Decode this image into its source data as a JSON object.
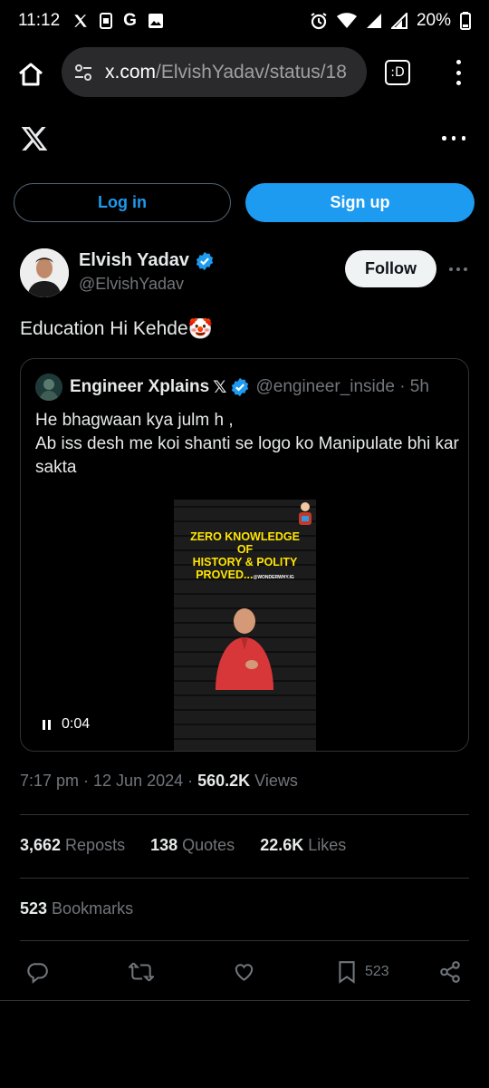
{
  "status_bar": {
    "time": "11:12",
    "battery": "20%",
    "icons": [
      "x-icon",
      "sim-icon",
      "google-icon",
      "image-icon",
      "alarm-icon",
      "wifi-icon",
      "signal-icon",
      "battery-icon"
    ]
  },
  "browser": {
    "url_host": "x.com",
    "url_path": "/ElvishYadav/status/18",
    "tabs_label": ":D"
  },
  "header": {
    "login_label": "Log in",
    "signup_label": "Sign up"
  },
  "tweet": {
    "author_name": "Elvish Yadav",
    "author_handle": "@ElvishYadav",
    "follow_label": "Follow",
    "text": "Education Hi Kehde",
    "emoji": "🤡",
    "date": "7:17 pm · 12 Jun 2024 · ",
    "views_count": "560.2K",
    "views_label": " Views",
    "reposts_count": "3,662",
    "reposts_label": " Reposts",
    "quotes_count": "138",
    "quotes_label": " Quotes",
    "likes_count": "22.6K",
    "likes_label": " Likes",
    "bookmarks_count": "523",
    "bookmarks_label": " Bookmarks",
    "bookmark_action_count": "523"
  },
  "quoted": {
    "name": "Engineer Xplains",
    "x_symbol": "𝕏",
    "handle": "@engineer_inside · 5h",
    "text_line1": "He bhagwaan kya julm h ,",
    "text_line2": "Ab iss desh me koi shanti se logo ko Manipulate bhi kar sakta",
    "media_title_line1": "ZERO KNOWLEDGE",
    "media_title_line2": "OF",
    "media_title_line3": "HISTORY & POLITY",
    "media_title_line4": "PROVED...",
    "media_watermark": "@WONDERWHY.IG",
    "video_time": "0:04"
  },
  "colors": {
    "accent": "#1d9bf0",
    "background": "#000000",
    "muted": "#71767b",
    "border": "#2f3336"
  }
}
